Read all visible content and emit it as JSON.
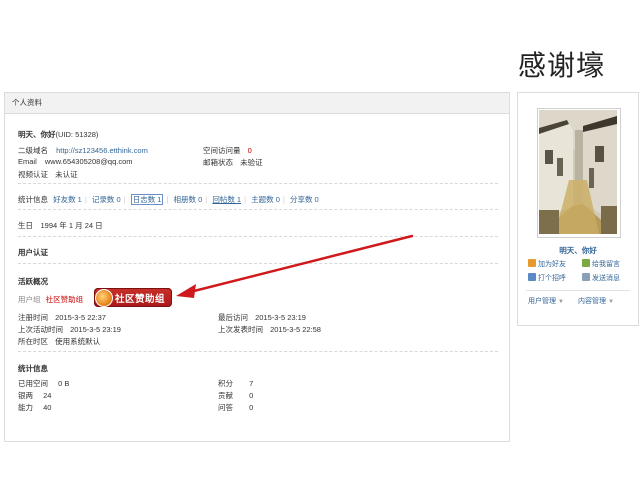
{
  "slide_title": "感谢壕",
  "panel": {
    "header": "个人资料",
    "username": "明天、你好",
    "uid": "(UID: 51328)",
    "domain_label": "二级域名",
    "domain_value": "http://sz123456.etthink.com",
    "space_visits_label": "空间访问量",
    "space_visits_value": "0",
    "email_label": "Email",
    "email_value": "www.654305208@qq.com",
    "mail_status_label": "邮箱状态",
    "mail_status_value": "未验证",
    "video_auth_label": "视频认证",
    "video_auth_value": "未认证",
    "stats_label": "统计信息",
    "stats": [
      {
        "label": "好友数 1"
      },
      {
        "label": "记录数 0"
      },
      {
        "label": "日志数 1"
      },
      {
        "label": "相册数 0"
      },
      {
        "label": "回帖数 1"
      },
      {
        "label": "主题数 0"
      },
      {
        "label": "分享数 0"
      }
    ],
    "birthday": "生日　1994 年 1 月 24 日",
    "user_auth_title": "用户认证",
    "active_title": "活跃概况",
    "user_group_label": "用户组",
    "user_group_value": "社区赞助组",
    "badge_text": "社区赞助组",
    "reg_time_label": "注册时间",
    "reg_time_value": "2015-3-5 22:37",
    "last_visit_label": "最后访问",
    "last_visit_value": "2015-3-5 23:19",
    "last_active_label": "上次活动时间",
    "last_active_value": "2015-3-5 23:19",
    "last_post_label": "上次发表时间",
    "last_post_value": "2015-3-5 22:58",
    "timezone_label": "所在时区",
    "timezone_value": "使用系统默认",
    "stats_info_title": "统计信息",
    "used_space_label": "已用空间",
    "used_space_value": "0 B",
    "points_label": "积分",
    "points_value": "7",
    "silver_label": "银两",
    "silver_value": "24",
    "contrib_label": "贡献",
    "contrib_value": "0",
    "ability_label": "能力",
    "ability_value": "40",
    "question_label": "问答",
    "question_value": "0"
  },
  "sidebar": {
    "name": "明天、你好",
    "add_friend": "加为好友",
    "leave_message": "给我留言",
    "say_hello": "打个招呼",
    "send_message": "发送消息",
    "user_manage": "用户管理",
    "content_manage": "内容管理"
  },
  "colors": {
    "link": "#336699",
    "badge": "#b8221e",
    "arrow": "#d0191c"
  }
}
